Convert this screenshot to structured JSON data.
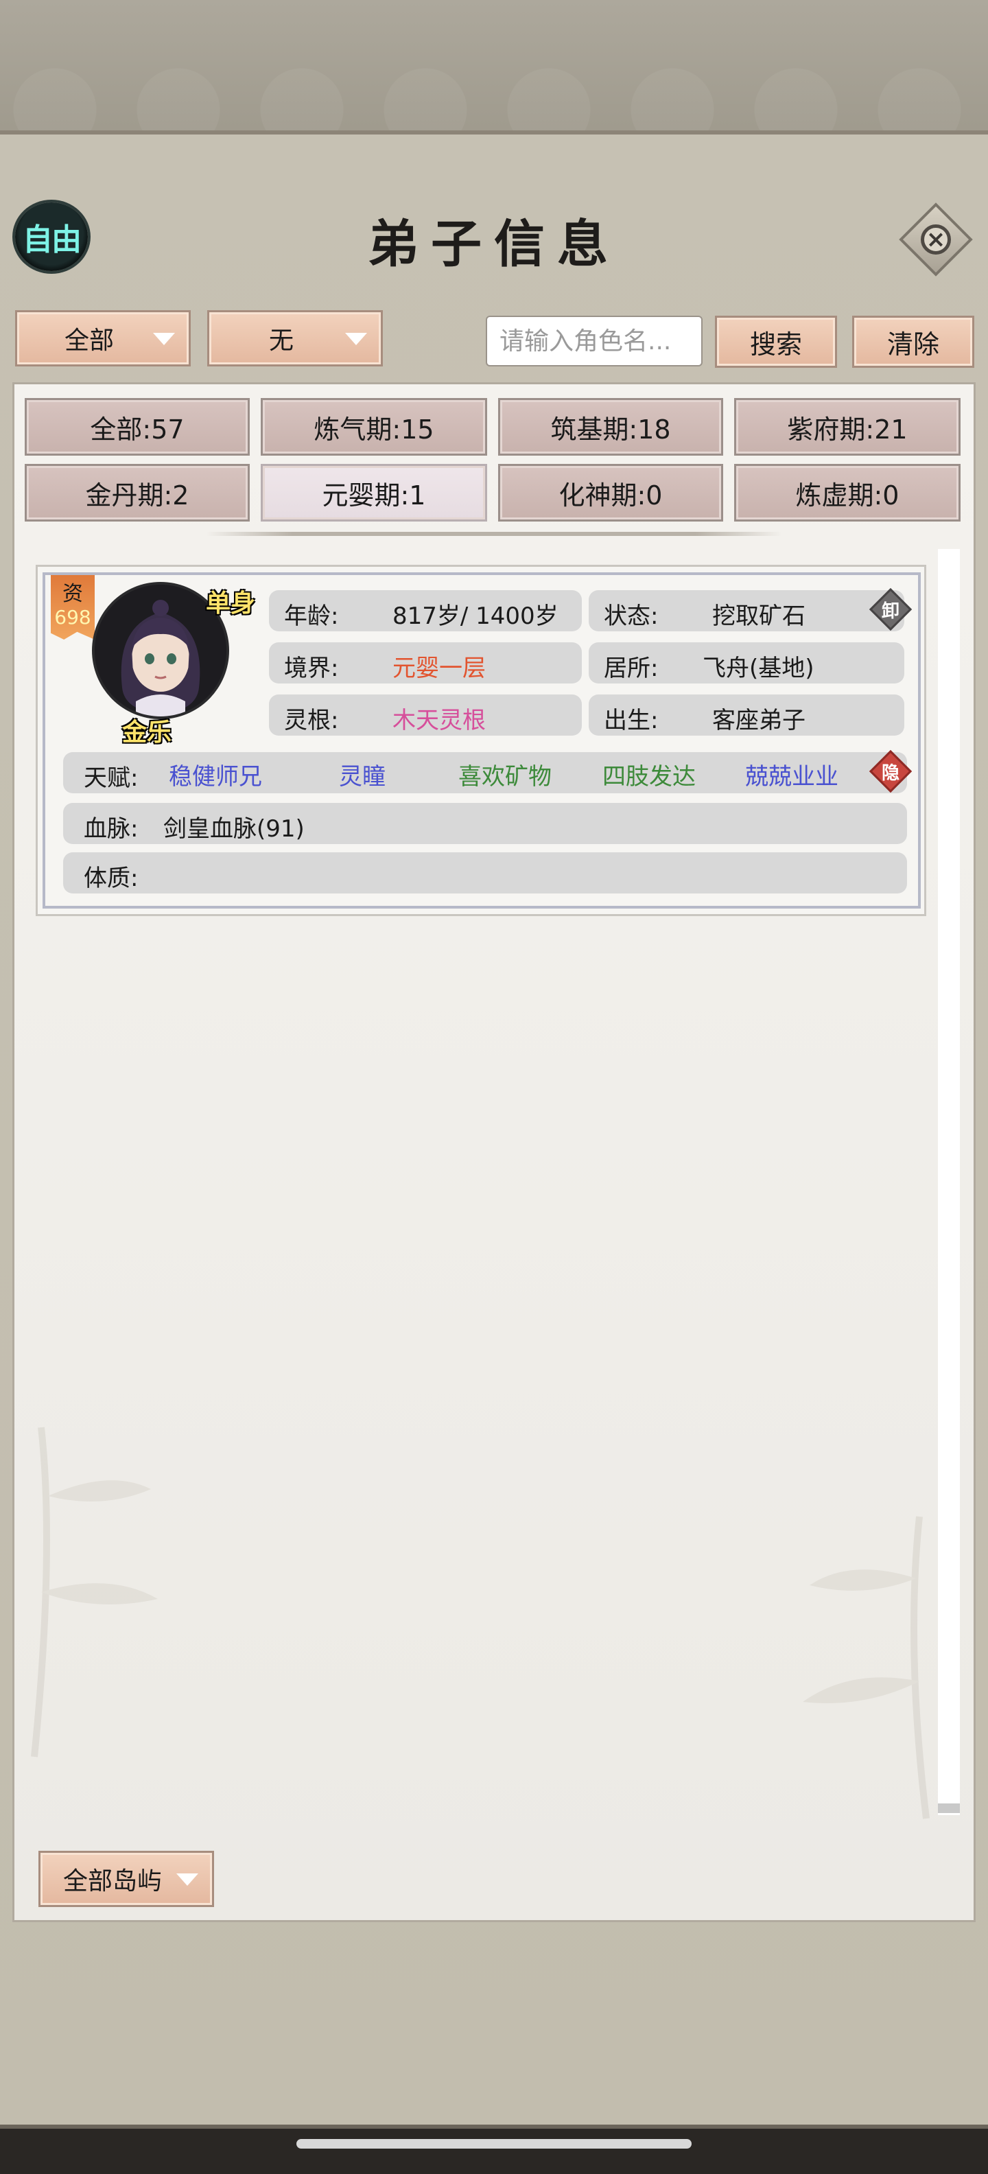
{
  "header": {
    "mode_badge": "自由",
    "title": "弟子信息"
  },
  "filters": {
    "filter1": "全部",
    "filter2": "无",
    "search_placeholder": "请输入角色名...",
    "search_label": "搜索",
    "clear_label": "清除"
  },
  "stage_tabs": [
    "全部:57",
    "炼气期:15",
    "筑基期:18",
    "紫府期:21",
    "金丹期:2",
    "元婴期:1",
    "化神期:0",
    "炼虚期:0"
  ],
  "active_stage_tab": "元婴期:1",
  "disciple": {
    "aptitude_label": "资",
    "aptitude_value": "698",
    "marital_status": "单身",
    "name": "金乐",
    "age_label": "年龄:",
    "age_value": "817岁/ 1400岁",
    "status_label": "状态:",
    "status_value": "挖取矿石",
    "unequip_label": "卸",
    "realm_label": "境界:",
    "realm_value": "元婴一层",
    "residence_label": "居所:",
    "residence_value": "飞舟(基地)",
    "spirit_root_label": "灵根:",
    "spirit_root_value": "木天灵根",
    "origin_label": "出生:",
    "origin_value": "客座弟子",
    "talent_label": "天赋:",
    "talents": [
      {
        "text": "稳健师兄",
        "color": "#4a52d0"
      },
      {
        "text": "灵瞳",
        "color": "#4a52d0"
      },
      {
        "text": "喜欢矿物",
        "color": "#3d8a3a"
      },
      {
        "text": "四肢发达",
        "color": "#3d8a3a"
      },
      {
        "text": "兢兢业业",
        "color": "#4a52d0"
      }
    ],
    "hide_label": "隐",
    "bloodline_label": "血脉:",
    "bloodline_value": "剑皇血脉(91)",
    "physique_label": "体质:",
    "physique_value": ""
  },
  "region_filter": "全部岛屿",
  "colors": {
    "realm": "#e2542f",
    "spirit_root": "#d64f9b",
    "mode_badge_text": "#7ef2e6",
    "name_text": "#ffe36a"
  }
}
